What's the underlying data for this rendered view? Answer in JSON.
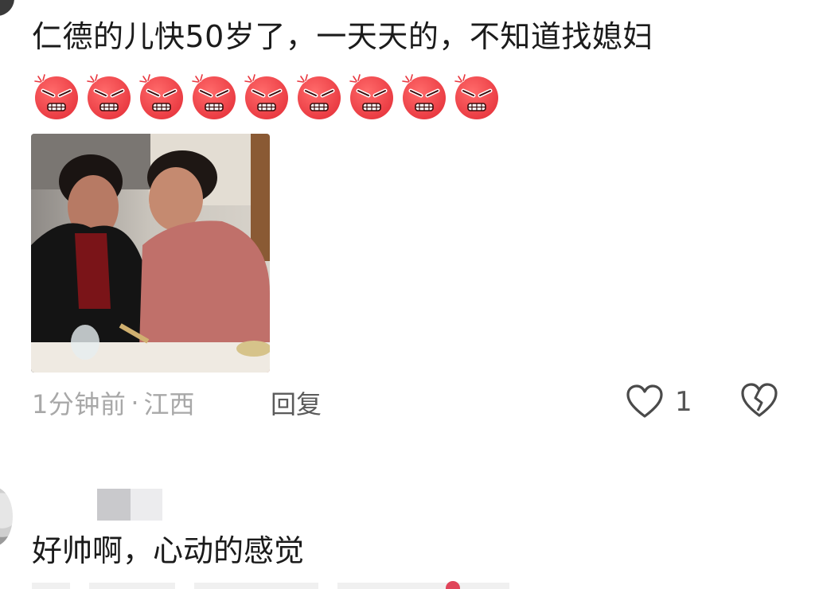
{
  "comments": [
    {
      "text": "仁德的儿快50岁了，一天天的，不知道找媳妇",
      "emoji_name": "rage-face-emoji",
      "emoji_count": 9,
      "time": "1分钟前",
      "separator": "·",
      "location": "江西",
      "reply_label": "回复",
      "likes": "1"
    },
    {
      "text": "好帅啊，心动的感觉"
    }
  ],
  "colors": {
    "text": "#1b1b1b",
    "meta": "#a8a8a8",
    "emoji_red": "#e8373f"
  }
}
